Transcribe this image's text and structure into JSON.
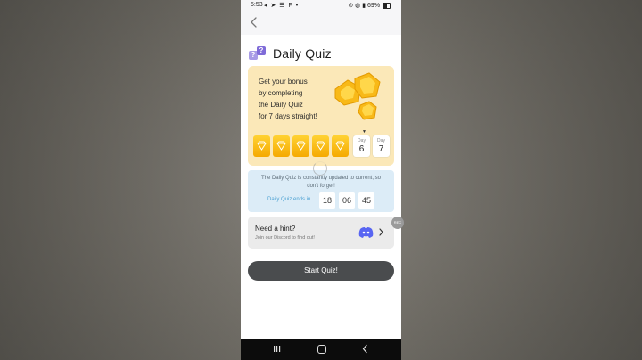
{
  "status_bar": {
    "time": "5:53",
    "left_icons": "◂ ➤ ☰ F •",
    "battery": "69%",
    "right_icons": "⊙ ◍ ▮"
  },
  "page": {
    "title": "Daily Quiz"
  },
  "bonus": {
    "lines": [
      "Get your bonus",
      "by completing",
      "the Daily Quiz",
      "for 7 days straight!"
    ],
    "day_label": "Day",
    "days_completed": 5,
    "day6_number": "6",
    "day7_number": "7",
    "current_marker": "▼"
  },
  "info": {
    "text": "The Daily Quiz is constantly updated to current, so don't forget!",
    "timer_label": "Daily Quiz ends in",
    "hours": "18",
    "minutes": "06",
    "seconds": "45"
  },
  "hint": {
    "title": "Need a hint?",
    "subtitle": "Join our Discord to find out!"
  },
  "side_bubble": "REC",
  "start_button": "Start Quiz!",
  "colors": {
    "bonus_bg": "#fbe8b8",
    "gem_gold": "#f5b400",
    "info_bg": "#dcecf7",
    "timer_label": "#4aa0d2",
    "discord": "#5865f2",
    "start_button": "#4a4c4e"
  }
}
